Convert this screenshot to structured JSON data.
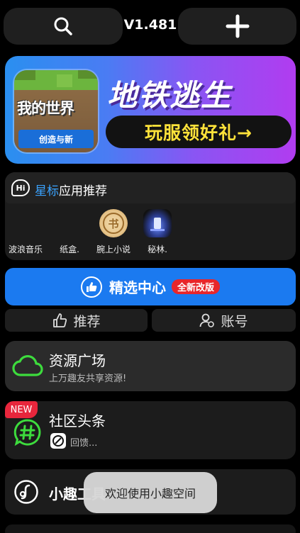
{
  "header": {
    "version": "V1.481",
    "search_icon": "search-icon",
    "add_icon": "plus-icon"
  },
  "banner": {
    "game_title": "我的世界",
    "game_subtitle": "创造与新",
    "title": "地铁逃生",
    "cta": "玩服领好礼→"
  },
  "star_apps": {
    "badge": "Hi",
    "title_highlight": "星标",
    "title_rest": "应用推荐",
    "items": [
      {
        "label": "波浪音乐"
      },
      {
        "label": "纸盒."
      },
      {
        "label": "腕上小说",
        "icon_text": "书"
      },
      {
        "label": "秘林."
      }
    ]
  },
  "select_center": {
    "label": "精选中心",
    "badge": "全新改版"
  },
  "tabs": [
    {
      "label": "推荐"
    },
    {
      "label": "账号"
    }
  ],
  "resource": {
    "title": "资源广场",
    "subtitle": "上万趣友共享资源!"
  },
  "community": {
    "badge": "NEW",
    "title": "社区头条",
    "subtitle": "回馈..."
  },
  "tools": {
    "title": "小趣工具"
  },
  "toast": {
    "text": "欢迎使用小趣空间"
  },
  "colors": {
    "accent_blue": "#1b7af0",
    "green": "#3ddc3d",
    "badge_red": "#e8262a",
    "highlight_blue": "#3aa3ff",
    "cta_yellow": "#ffe23a"
  }
}
